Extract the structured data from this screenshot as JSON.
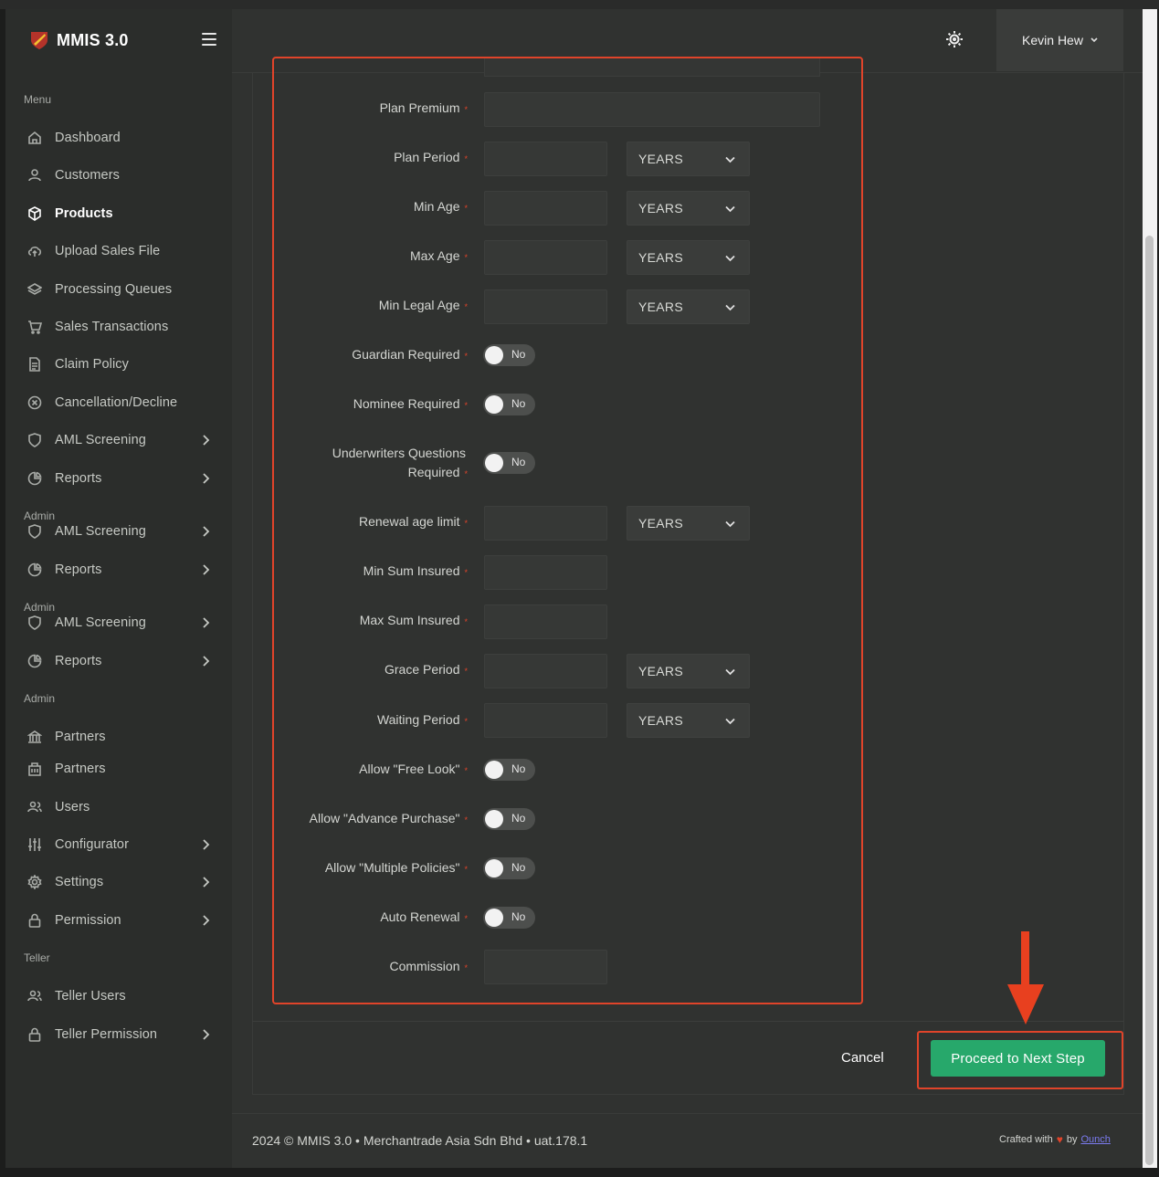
{
  "app": {
    "title": "MMIS 3.0"
  },
  "header": {
    "user_name": "Kevin Hew"
  },
  "sidebar": {
    "sections": {
      "menu": "Menu",
      "admin1": "Admin",
      "admin2": "Admin",
      "admin3": "Admin",
      "teller": "Teller"
    },
    "items": [
      {
        "label": "Dashboard",
        "icon": "home-icon"
      },
      {
        "label": "Customers",
        "icon": "user-icon"
      },
      {
        "label": "Products",
        "icon": "box-icon",
        "active": true
      },
      {
        "label": "Upload Sales File",
        "icon": "cloud-upload-icon"
      },
      {
        "label": "Processing Queues",
        "icon": "layers-icon"
      },
      {
        "label": "Sales Transactions",
        "icon": "cart-icon"
      },
      {
        "label": "Claim Policy",
        "icon": "document-icon"
      },
      {
        "label": "Cancellation/Decline",
        "icon": "x-circle-icon"
      },
      {
        "label": "AML Screening",
        "icon": "shield-icon"
      },
      {
        "label": "Reports",
        "icon": "pie-chart-icon"
      },
      {
        "label": "AML Screening",
        "icon": "shield-icon"
      },
      {
        "label": "Reports",
        "icon": "pie-chart-icon"
      },
      {
        "label": "AML Screening",
        "icon": "shield-icon"
      },
      {
        "label": "Reports",
        "icon": "pie-chart-icon"
      },
      {
        "label": "Partners",
        "icon": "bank-icon"
      },
      {
        "label": "Partners",
        "icon": "building-icon"
      },
      {
        "label": "Users",
        "icon": "users-icon"
      },
      {
        "label": "Configurator",
        "icon": "sliders-icon"
      },
      {
        "label": "Settings",
        "icon": "gear-icon"
      },
      {
        "label": "Permission",
        "icon": "lock-icon"
      },
      {
        "label": "Teller Users",
        "icon": "users-icon"
      },
      {
        "label": "Teller Permission",
        "icon": "lock-icon"
      }
    ]
  },
  "form": {
    "fields": [
      {
        "label": "Plan Premium",
        "value": ""
      },
      {
        "label": "Plan Period",
        "value": "",
        "unit": "YEARS"
      },
      {
        "label": "Min Age",
        "value": "",
        "unit": "YEARS"
      },
      {
        "label": "Max Age",
        "value": "",
        "unit": "YEARS"
      },
      {
        "label": "Min Legal Age",
        "value": "",
        "unit": "YEARS"
      },
      {
        "label": "Guardian Required",
        "toggle": "No"
      },
      {
        "label": "Nominee Required",
        "toggle": "No"
      },
      {
        "label_line1": "Underwriters Questions",
        "label_line2": "Required",
        "toggle": "No"
      },
      {
        "label": "Renewal age limit",
        "value": "",
        "unit": "YEARS"
      },
      {
        "label": "Min Sum Insured",
        "value": ""
      },
      {
        "label": "Max Sum Insured",
        "value": ""
      },
      {
        "label": "Grace Period",
        "value": "",
        "unit": "YEARS"
      },
      {
        "label": "Waiting Period",
        "value": "",
        "unit": "YEARS"
      },
      {
        "label": "Allow \"Free Look\"",
        "toggle": "No"
      },
      {
        "label": "Allow \"Advance Purchase\"",
        "toggle": "No"
      },
      {
        "label": "Allow \"Multiple Policies\"",
        "toggle": "No"
      },
      {
        "label": "Auto Renewal",
        "toggle": "No"
      },
      {
        "label": "Commission",
        "value": ""
      }
    ],
    "required_marker": "*"
  },
  "actions": {
    "cancel_label": "Cancel",
    "next_label": "Proceed to Next Step"
  },
  "footer": {
    "left_text": "2024 © MMIS 3.0 • Merchantrade Asia Sdn Bhd • uat.178.1",
    "crafted": "Crafted with",
    "by": "by",
    "link": "Ounch"
  },
  "colors": {
    "accent_green": "#27a86b",
    "annotation_red": "#e0442a",
    "background": "#303230"
  }
}
